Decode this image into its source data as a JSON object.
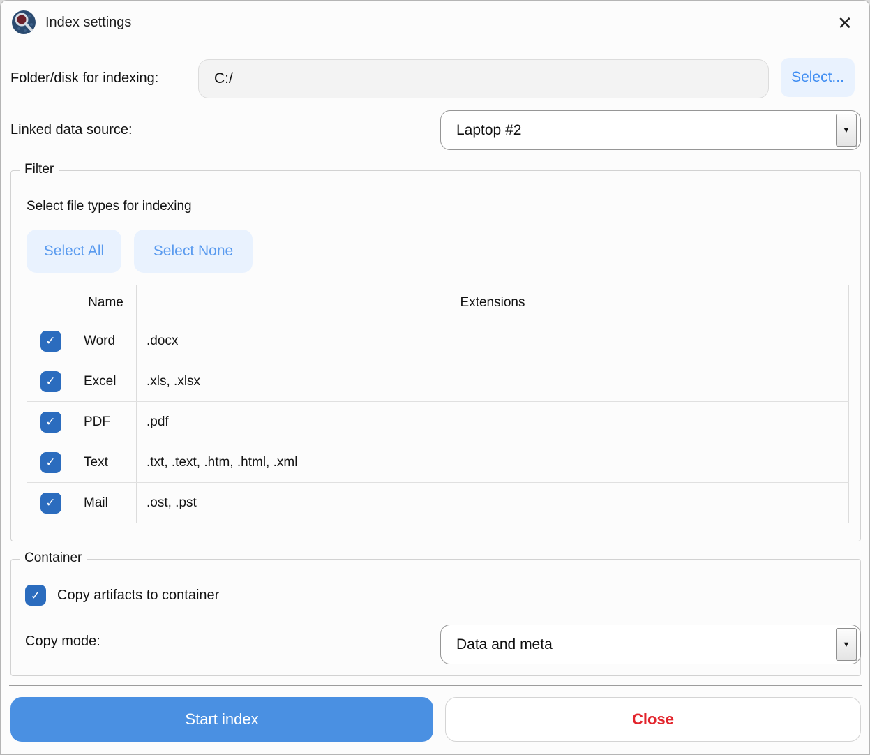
{
  "window": {
    "title": "Index settings"
  },
  "icons": {
    "close": "✕",
    "check": "✓",
    "dropdown_arrow": "▼"
  },
  "folder_row": {
    "label": "Folder/disk for indexing:",
    "value": "C:/",
    "select_button_label": "Select..."
  },
  "data_source_row": {
    "label": "Linked data source:",
    "selected_value": "Laptop #2"
  },
  "filter": {
    "legend": "Filter",
    "subtitle": "Select file types for indexing",
    "select_all_label": "Select All",
    "select_none_label": "Select None",
    "table": {
      "name_header": "Name",
      "extensions_header": "Extensions",
      "rows": [
        {
          "name": "Word",
          "extensions": ".docx",
          "checked": true
        },
        {
          "name": "Excel",
          "extensions": ".xls, .xlsx",
          "checked": true
        },
        {
          "name": "PDF",
          "extensions": ".pdf",
          "checked": true
        },
        {
          "name": "Text",
          "extensions": ".txt, .text, .htm, .html, .xml",
          "checked": true
        },
        {
          "name": "Mail",
          "extensions": ".ost, .pst",
          "checked": true
        }
      ]
    }
  },
  "container_section": {
    "legend": "Container",
    "copy_artifacts_label": "Copy artifacts to container",
    "copy_artifacts_checked": true,
    "copy_mode_label": "Copy mode:",
    "copy_mode_value": "Data and meta"
  },
  "actions": {
    "start_label": "Start index",
    "close_label": "Close"
  },
  "colors": {
    "accent_blue": "#4a90e2",
    "checkbox_blue": "#2b6cbe",
    "link_blue": "#3f8df2",
    "light_blue_bg": "#e9f2fe",
    "close_red": "#e2242c"
  }
}
